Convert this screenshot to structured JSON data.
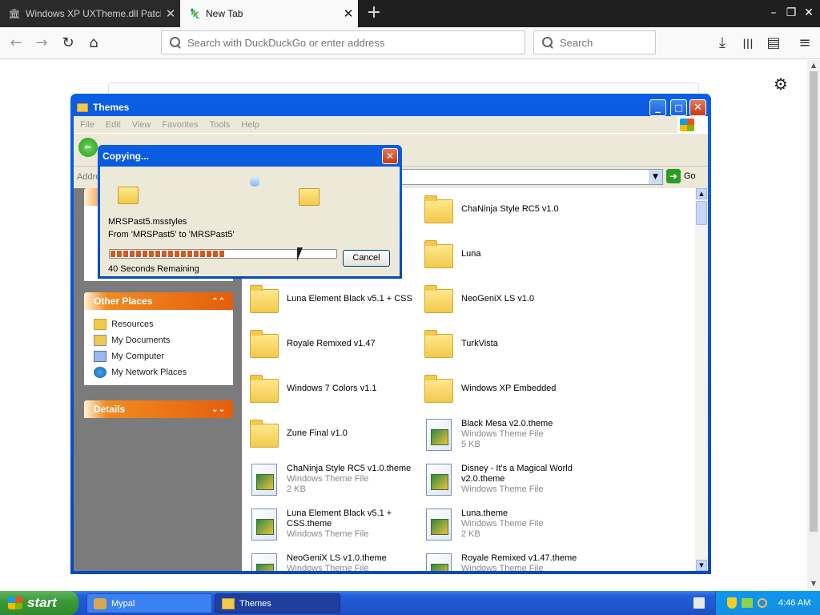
{
  "browser": {
    "tabs": [
      {
        "label": "Windows XP UXTheme.dll Patches",
        "icon": "columns-icon"
      },
      {
        "label": "New Tab",
        "icon": "firefox-tab-icon"
      }
    ],
    "new_tab_symbol": "+",
    "window_controls": {
      "minimize": "–",
      "restore": "❐",
      "close": "✕"
    },
    "nav": {
      "back": "←",
      "forward": "→",
      "reload": "↻",
      "home": "⌂"
    },
    "url_placeholder": "Search with DuckDuckGo or enter address",
    "search_placeholder": "Search",
    "toolbar_icons": {
      "download": "⤓",
      "library": "|||",
      "sidebar": "▤",
      "menu": "≡"
    },
    "gear": "⚙"
  },
  "explorer": {
    "title": "Themes",
    "menu": [
      "File",
      "Edit",
      "View",
      "Favorites",
      "Tools",
      "Help"
    ],
    "address_label": "Address",
    "go_label": "Go",
    "other_places": {
      "title": "Other Places",
      "items": [
        "Resources",
        "My Documents",
        "My Computer",
        "My Network Places"
      ]
    },
    "details_title": "Details",
    "files": [
      {
        "name": "ChaNinja Style RC5 v1.0",
        "kind": "folder"
      },
      {
        "name": "Luna",
        "kind": "folder"
      },
      {
        "name": "Luna Element Black v5.1 + CSS",
        "kind": "folder"
      },
      {
        "name": "NeoGeniX LS v1.0",
        "kind": "folder"
      },
      {
        "name": "Royale Remixed v1.47",
        "kind": "folder"
      },
      {
        "name": "TurkVista",
        "kind": "folder"
      },
      {
        "name": "Windows 7 Colors v1.1",
        "kind": "folder"
      },
      {
        "name": "Windows XP Embedded",
        "kind": "folder"
      },
      {
        "name": "Zune Final v1.0",
        "kind": "folder"
      },
      {
        "name": "Black Mesa v2.0.theme",
        "type": "Windows Theme File",
        "size": "5 KB",
        "kind": "theme"
      },
      {
        "name": "ChaNinja Style RC5 v1.0.theme",
        "type": "Windows Theme File",
        "size": "2 KB",
        "kind": "theme"
      },
      {
        "name": "Disney - It's a Magical World v2.0.theme",
        "type": "Windows Theme File",
        "size": "",
        "kind": "theme"
      },
      {
        "name": "Luna Element Black v5.1 + CSS.theme",
        "type": "Windows Theme File",
        "size": "",
        "kind": "theme"
      },
      {
        "name": "Luna.theme",
        "type": "Windows Theme File",
        "size": "2 KB",
        "kind": "theme"
      },
      {
        "name": "NeoGeniX LS v1.0.theme",
        "type": "Windows Theme File",
        "size": "",
        "kind": "theme"
      },
      {
        "name": "Royale Remixed v1.47.theme",
        "type": "Windows Theme File",
        "size": "",
        "kind": "theme"
      }
    ]
  },
  "copy_dialog": {
    "title": "Copying...",
    "file": "MRSPast5.msstyles",
    "from_to": "From 'MRSPast5' to 'MRSPast5'",
    "progress": 0.51,
    "remaining": "40 Seconds Remaining",
    "cancel_label": "Cancel"
  },
  "taskbar": {
    "start_label": "start",
    "items": [
      {
        "label": "Mypal",
        "active": false
      },
      {
        "label": "Themes",
        "active": true
      }
    ],
    "clock": "4:46 AM"
  }
}
